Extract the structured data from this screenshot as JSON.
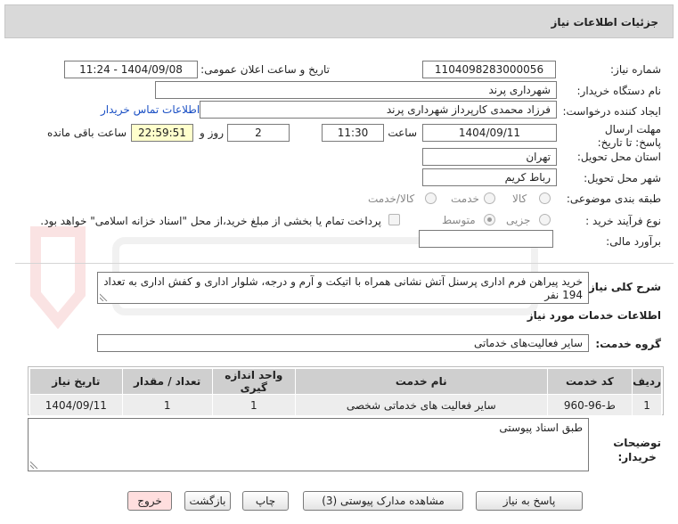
{
  "header": {
    "title": "جزئیات اطلاعات نیاز"
  },
  "fields": {
    "need_number_label": "شماره نیاز:",
    "need_number": "1104098283000056",
    "announce_label": "تاریخ و ساعت اعلان عمومی:",
    "announce_value": "1404/09/08 - 11:24",
    "buyer_org_label": "نام دستگاه خریدار:",
    "buyer_org": "شهرداری پرند",
    "creator_label": "ایجاد کننده درخواست:",
    "creator": "فرزاد محمدی کارپرداز شهرداری پرند",
    "contact_link": "اطلاعات تماس خریدار",
    "deadline_label": "مهلت ارسال پاسخ: تا تاریخ:",
    "deadline_date": "1404/09/11",
    "time_label": "ساعت",
    "deadline_time": "11:30",
    "days_value": "2",
    "days_label": "روز و",
    "remaining_time": "22:59:51",
    "remaining_label": "ساعت باقی مانده",
    "province_label": "استان محل تحویل:",
    "province": "تهران",
    "city_label": "شهر محل تحویل:",
    "city": "رباط کریم",
    "category_label": "طبقه بندی موضوعی:",
    "category_options": [
      "کالا",
      "خدمت",
      "کالا/خدمت"
    ],
    "process_label": "نوع فرآیند خرید :",
    "process_options": [
      "جزیی",
      "متوسط"
    ],
    "payment_note": "پرداخت تمام یا بخشی از مبلغ خرید،از محل \"اسناد خزانه اسلامی\" خواهد بود.",
    "estimate_label": "برآورد مالی:",
    "estimate": ""
  },
  "description": {
    "label": "شرح کلی نیاز:",
    "text": "خرید پیراهن فرم اداری پرسنل آتش نشانی همراه با اتیکت و آرم و درجه، شلوار اداری و کفش اداری به تعداد 194 نفر"
  },
  "services": {
    "section_title": "اطلاعات خدمات مورد نیاز",
    "group_label": "گروه خدمت:",
    "group_value": "سایر فعالیت‌های خدماتی",
    "columns": [
      "ردیف",
      "کد خدمت",
      "نام خدمت",
      "واحد اندازه گیری",
      "تعداد / مقدار",
      "تاریخ نیاز"
    ],
    "rows": [
      [
        "1",
        "ط-96-960",
        "سایر فعالیت های خدماتی شخصی",
        "1",
        "1",
        "1404/09/11"
      ]
    ]
  },
  "notes": {
    "label_line1": "توضیحات",
    "label_line2": "خریدار:",
    "text": "طبق اسناد پیوستی"
  },
  "buttons": {
    "reply": "پاسخ به نیاز",
    "attachments": "مشاهده مدارک پیوستی (3)",
    "print": "چاپ",
    "back": "بازگشت",
    "exit": "خروج"
  }
}
